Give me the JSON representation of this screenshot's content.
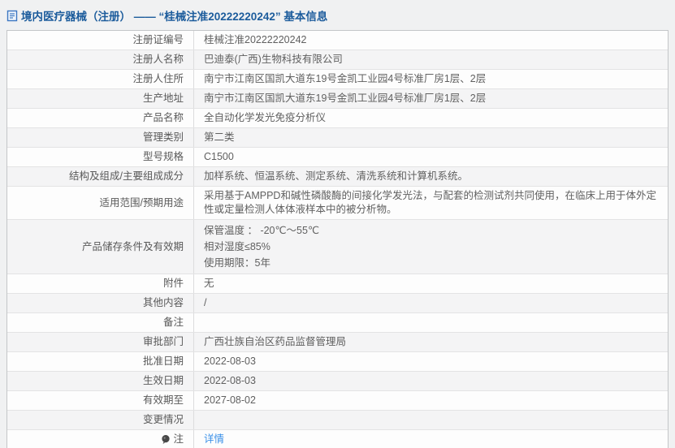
{
  "page": {
    "title": "境内医疗器械（注册） —— “桂械注准20222220242” 基本信息"
  },
  "icons": {
    "header": "document-icon",
    "note_row": "note-icon"
  },
  "colors": {
    "title_blue": "#1c5c9c",
    "link_blue": "#3a90e8",
    "row_stripe": "#f4f4f5",
    "border": "#c4c6c8"
  },
  "table": {
    "rows": [
      {
        "label": "注册证编号",
        "value": "桂械注准20222220242"
      },
      {
        "label": "注册人名称",
        "value": "巴迪泰(广西)生物科技有限公司"
      },
      {
        "label": "注册人住所",
        "value": "南宁市江南区国凯大道东19号金凯工业园4号标准厂房1层、2层"
      },
      {
        "label": "生产地址",
        "value": "南宁市江南区国凯大道东19号金凯工业园4号标准厂房1层、2层"
      },
      {
        "label": "产品名称",
        "value": "全自动化学发光免疫分析仪"
      },
      {
        "label": "管理类别",
        "value": "第二类"
      },
      {
        "label": "型号规格",
        "value": "C1500"
      },
      {
        "label": "结构及组成/主要组成成分",
        "value": "加样系统、恒温系统、测定系统、清洗系统和计算机系统。"
      },
      {
        "label": "适用范围/预期用途",
        "value": "采用基于AMPPD和碱性磷酸酶的间接化学发光法，与配套的检测试剂共同使用，在临床上用于体外定性或定量检测人体体液样本中的被分析物。"
      },
      {
        "label": "产品储存条件及有效期",
        "lines": [
          "保管温度 ： -20℃～55℃",
          "相对湿度≤85%",
          "使用期限：5年"
        ]
      },
      {
        "label": "附件",
        "value": "无"
      },
      {
        "label": "其他内容",
        "value": "/"
      },
      {
        "label": "备注",
        "value": ""
      },
      {
        "label": "审批部门",
        "value": "广西壮族自治区药品监督管理局"
      },
      {
        "label": "批准日期",
        "value": "2022-08-03"
      },
      {
        "label": "生效日期",
        "value": "2022-08-03"
      },
      {
        "label": "有效期至",
        "value": "2027-08-02"
      },
      {
        "label": "变更情况",
        "value": ""
      },
      {
        "label": "注",
        "icon": "note-icon",
        "value": "详情",
        "link": true
      }
    ]
  }
}
